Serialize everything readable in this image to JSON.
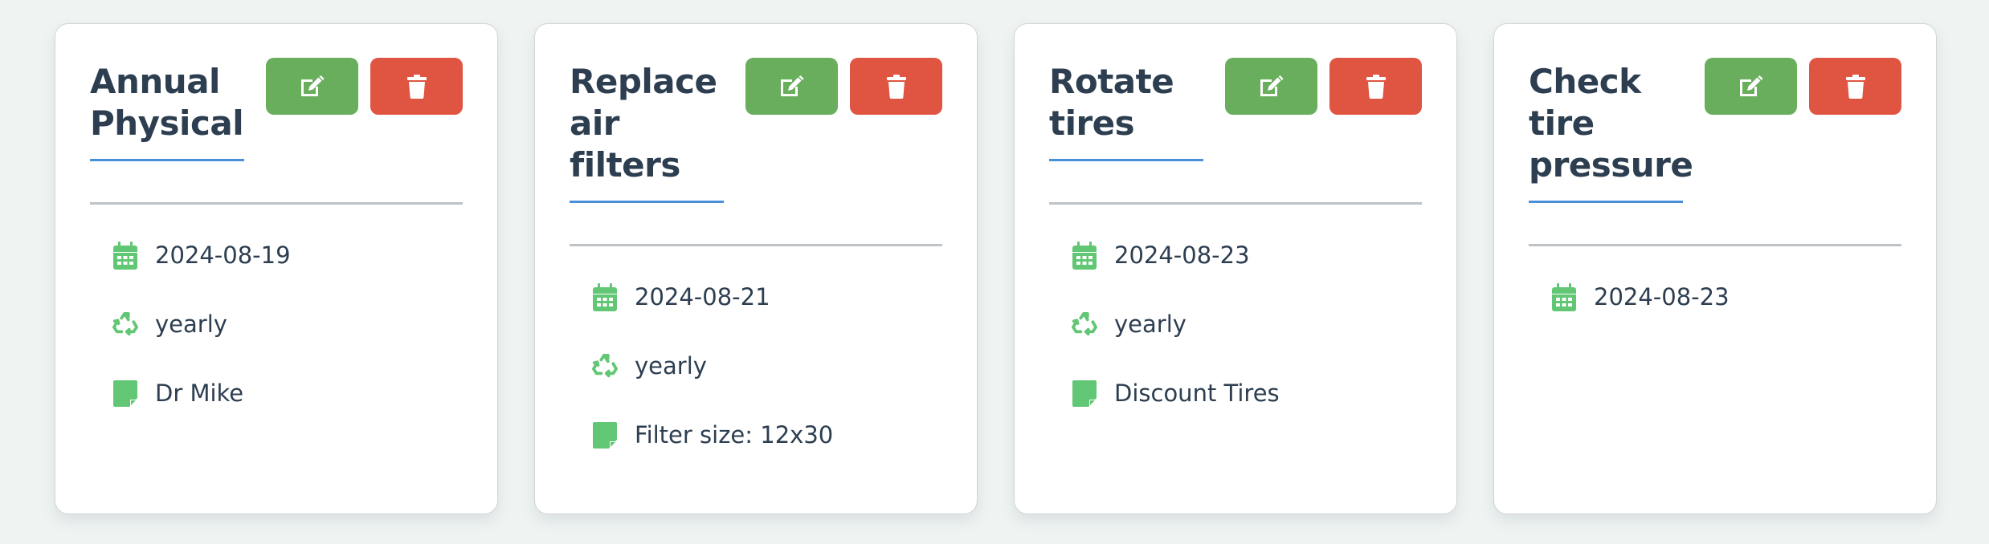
{
  "colors": {
    "background": "#eff4f3",
    "edit_button": "#68ae5c",
    "delete_button": "#e05442",
    "icon_green": "#62c774",
    "title_underline": "#4a90d9",
    "separator": "#bdc3c7",
    "text": "#2c3e50"
  },
  "icons": {
    "edit": "edit-square-pencil-icon",
    "delete": "trash-icon",
    "date": "calendar-icon",
    "recurrence": "recycle-icon",
    "note": "sticky-note-icon"
  },
  "cards": [
    {
      "title": "Annual Physical",
      "date": "2024-08-19",
      "recurrence": "yearly",
      "note": "Dr Mike"
    },
    {
      "title": "Replace air filters",
      "date": "2024-08-21",
      "recurrence": "yearly",
      "note": "Filter size: 12x30"
    },
    {
      "title": "Rotate tires",
      "date": "2024-08-23",
      "recurrence": "yearly",
      "note": "Discount Tires"
    },
    {
      "title": "Check tire pressure",
      "date": "2024-08-23"
    }
  ]
}
